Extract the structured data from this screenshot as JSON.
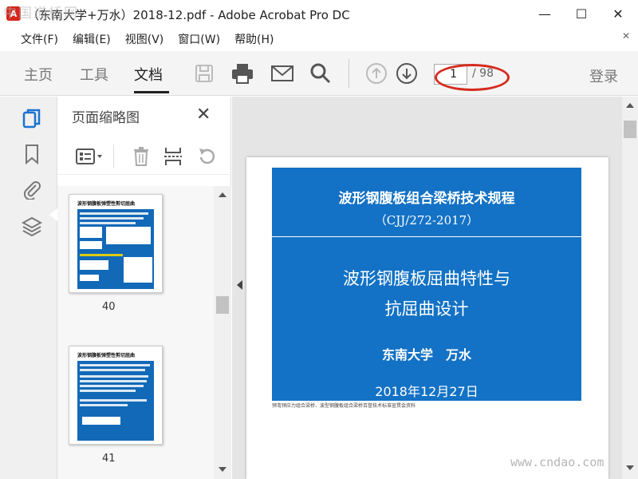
{
  "window": {
    "title": "（东南大学+万水）2018-12.pdf - Adobe Acrobat Pro DC",
    "watermark_top": "中国道桥网",
    "minimize": "—",
    "maximize": "☐",
    "close": "✕"
  },
  "menu": {
    "items": [
      "文件(F)",
      "编辑(E)",
      "视图(V)",
      "窗口(W)",
      "帮助(H)"
    ],
    "close_glyph": "✕"
  },
  "toolbar": {
    "tabs": [
      "主页",
      "工具",
      "文档"
    ],
    "active_tab": "文档",
    "page_current": "1",
    "page_total": "/ 98",
    "login": "登录",
    "icons": [
      "save-icon",
      "print-icon",
      "mail-icon",
      "search-icon",
      "page-up-icon",
      "page-down-icon"
    ]
  },
  "left_rail": {
    "icons": [
      "pages-icon",
      "bookmark-icon",
      "attachment-icon",
      "layers-icon"
    ]
  },
  "thumbnail_panel": {
    "title": "页面缩略图",
    "close_glyph": "✕",
    "thumbs": [
      {
        "title": "波形钢腹板弹塑性剪切屈曲",
        "number": "40"
      },
      {
        "title": "波形钢腹板弹塑性剪切屈曲",
        "number": "41"
      }
    ]
  },
  "document": {
    "header_line1": "波形钢腹板组合梁桥技术规程",
    "header_line2": "（CJJ/272-2017）",
    "title_line1": "波形钢腹板屈曲特性与",
    "title_line2": "抗屈曲设计",
    "author": "东南大学　万水",
    "date": "2018年12月27日",
    "footnote": "预弯预应力组合梁桥、波型钢腹板组合梁桥百誉技术标准宣贯会资料"
  },
  "watermark_bottom": "www.cndao.com",
  "colors": {
    "slide_blue": "#1372c5",
    "annotation_red": "#d62b1e",
    "app_red": "#d7261d"
  }
}
